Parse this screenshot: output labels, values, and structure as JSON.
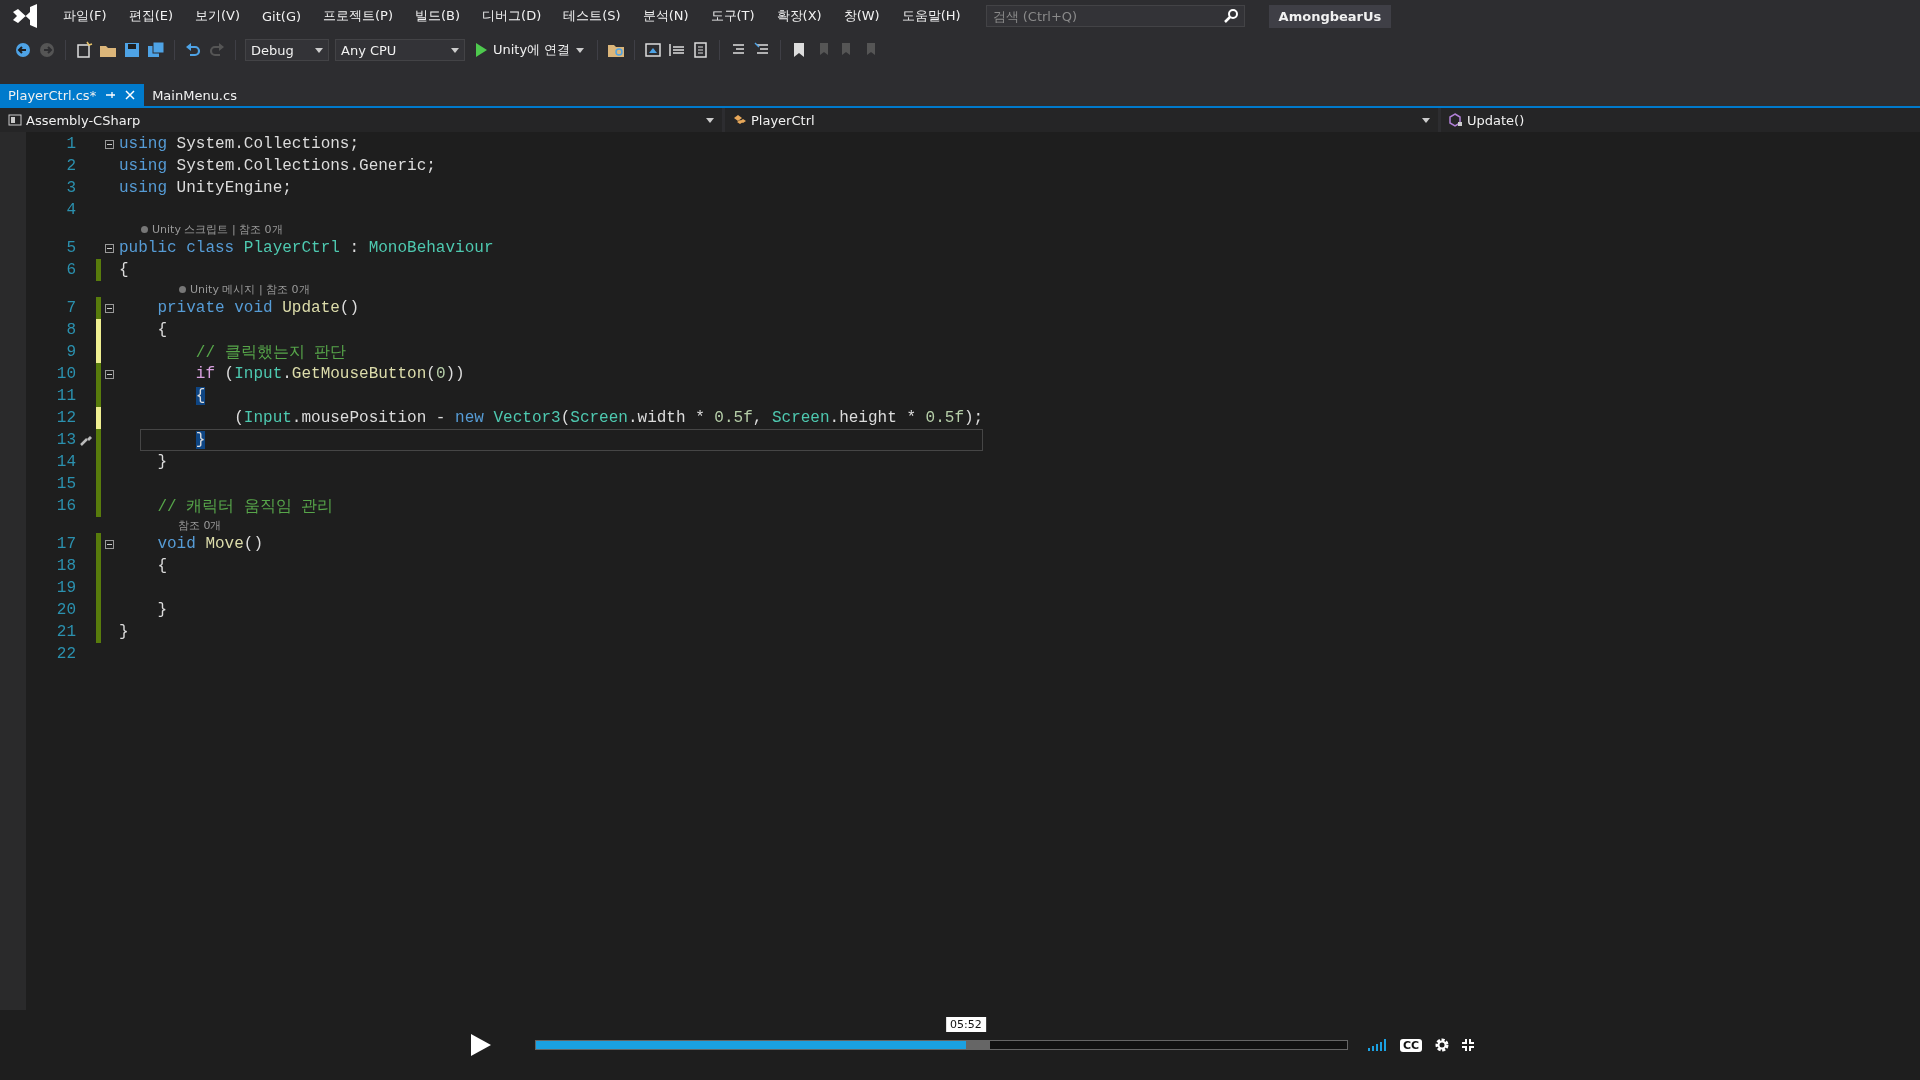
{
  "menu": [
    "파일(F)",
    "편집(E)",
    "보기(V)",
    "Git(G)",
    "프로젝트(P)",
    "빌드(B)",
    "디버그(D)",
    "테스트(S)",
    "분석(N)",
    "도구(T)",
    "확장(X)",
    "창(W)",
    "도움말(H)"
  ],
  "search": {
    "placeholder": "검색 (Ctrl+Q)"
  },
  "solution_name": "AmongbearUs",
  "toolbar": {
    "configuration": "Debug",
    "platform": "Any CPU",
    "run_label": "Unity에 연결"
  },
  "tabs": [
    {
      "label": "PlayerCtrl.cs*",
      "selected": true
    },
    {
      "label": "MainMenu.cs",
      "selected": false
    }
  ],
  "navigation": [
    "Assembly-CSharp",
    "PlayerCtrl",
    "Update()"
  ],
  "lines": [
    {
      "kind": "code",
      "number": "1",
      "fold": true,
      "current": false,
      "tokens": [
        {
          "kind": "keyword",
          "text": "using"
        },
        {
          "kind": "plain",
          "text": " System.Collections;"
        }
      ]
    },
    {
      "kind": "code",
      "number": "2",
      "fold": false,
      "current": false,
      "tokens": [
        {
          "kind": "keyword",
          "text": "using"
        },
        {
          "kind": "plain",
          "text": " System.Collections.Generic;"
        }
      ]
    },
    {
      "kind": "code",
      "number": "3",
      "fold": false,
      "current": false,
      "tokens": [
        {
          "kind": "keyword",
          "text": "using"
        },
        {
          "kind": "plain",
          "text": " UnityEngine;"
        }
      ]
    },
    {
      "kind": "code",
      "number": "4",
      "fold": false,
      "current": false
    },
    {
      "kind": "lens",
      "icon": true,
      "text": "Unity 스크립트 | 참조 0개"
    },
    {
      "kind": "code",
      "number": "5",
      "fold": true,
      "current": false,
      "tokens": [
        {
          "kind": "keyword",
          "text": "public"
        },
        {
          "kind": "keyword",
          "text": " class"
        },
        {
          "kind": "type",
          "text": " PlayerCtrl"
        },
        {
          "kind": "plain",
          "text": " : "
        },
        {
          "kind": "type",
          "text": "MonoBehaviour"
        }
      ]
    },
    {
      "kind": "code",
      "number": "6",
      "fold": false,
      "change": {
        "color": "#587c0c"
      },
      "current": false,
      "tokens": [
        {
          "kind": "plain",
          "text": "{"
        }
      ]
    },
    {
      "kind": "lens",
      "icon": true,
      "text": "Unity 메시지 | 참조 0개"
    },
    {
      "kind": "code",
      "number": "7",
      "fold": true,
      "change": {
        "color": "#587c0c"
      },
      "current": false,
      "tokens": [
        {
          "kind": "keyword",
          "text": "    private"
        },
        {
          "kind": "keyword",
          "text": " void"
        },
        {
          "kind": "method",
          "text": " Update"
        },
        {
          "kind": "plain",
          "text": "()"
        }
      ]
    },
    {
      "kind": "code",
      "number": "8",
      "fold": false,
      "change": {
        "color": "#efef91"
      },
      "current": false,
      "tokens": [
        {
          "kind": "plain",
          "text": "    {"
        }
      ]
    },
    {
      "kind": "code",
      "number": "9",
      "fold": false,
      "change": {
        "color": "#efef91"
      },
      "current": false,
      "tokens": [
        {
          "kind": "comment",
          "text": "        // 클릭했는지 판단"
        }
      ]
    },
    {
      "kind": "code",
      "number": "10",
      "fold": true,
      "change": {
        "color": "#587c0c"
      },
      "current": false,
      "tokens": [
        {
          "kind": "control",
          "text": "        if"
        },
        {
          "kind": "plain",
          "text": " ("
        },
        {
          "kind": "type",
          "text": "Input"
        },
        {
          "kind": "plain",
          "text": "."
        },
        {
          "kind": "method",
          "text": "GetMouseButton"
        },
        {
          "kind": "plain",
          "text": "("
        },
        {
          "kind": "number",
          "text": "0"
        },
        {
          "kind": "plain",
          "text": "))"
        }
      ]
    },
    {
      "kind": "code",
      "number": "11",
      "fold": false,
      "change": {
        "color": "#587c0c"
      },
      "current": false,
      "tokens": [
        {
          "kind": "brace-match",
          "text": "        {"
        }
      ]
    },
    {
      "kind": "code",
      "number": "12",
      "fold": false,
      "change": {
        "color": "#efef91"
      },
      "current": false,
      "tokens": [
        {
          "kind": "plain",
          "text": "            ("
        },
        {
          "kind": "type",
          "text": "Input"
        },
        {
          "kind": "plain",
          "text": ".mousePosition - "
        },
        {
          "kind": "keyword",
          "text": "new"
        },
        {
          "kind": "type",
          "text": " Vector3"
        },
        {
          "kind": "plain",
          "text": "("
        },
        {
          "kind": "type",
          "text": "Screen"
        },
        {
          "kind": "plain",
          "text": ".width * "
        },
        {
          "kind": "number",
          "text": "0.5f"
        },
        {
          "kind": "plain",
          "text": ", "
        },
        {
          "kind": "type",
          "text": "Screen"
        },
        {
          "kind": "plain",
          "text": ".height * "
        },
        {
          "kind": "number",
          "text": "0.5f"
        },
        {
          "kind": "plain",
          "text": ");"
        }
      ]
    },
    {
      "kind": "code",
      "number": "13",
      "fold": false,
      "change": {
        "color": "#587c0c"
      },
      "current": true,
      "tokens": [
        {
          "kind": "brace-match",
          "text": "        }"
        }
      ]
    },
    {
      "kind": "code",
      "number": "14",
      "fold": false,
      "change": {
        "color": "#587c0c"
      },
      "current": false,
      "tokens": [
        {
          "kind": "plain",
          "text": "    }"
        }
      ]
    },
    {
      "kind": "code",
      "number": "15",
      "fold": false,
      "change": {
        "color": "#587c0c"
      },
      "current": false
    },
    {
      "kind": "code",
      "number": "16",
      "fold": false,
      "change": {
        "color": "#587c0c"
      },
      "current": false,
      "tokens": [
        {
          "kind": "comment",
          "text": "    // 캐릭터 움직임 관리"
        }
      ]
    },
    {
      "kind": "lens",
      "icon": false,
      "text": "참조 0개"
    },
    {
      "kind": "code",
      "number": "17",
      "fold": true,
      "change": {
        "color": "#587c0c"
      },
      "current": false,
      "tokens": [
        {
          "kind": "keyword",
          "text": "    void"
        },
        {
          "kind": "method",
          "text": " Move"
        },
        {
          "kind": "plain",
          "text": "()"
        }
      ]
    },
    {
      "kind": "code",
      "number": "18",
      "fold": false,
      "change": {
        "color": "#587c0c"
      },
      "current": false,
      "tokens": [
        {
          "kind": "plain",
          "text": "    {"
        }
      ]
    },
    {
      "kind": "code",
      "number": "19",
      "fold": false,
      "change": {
        "color": "#587c0c"
      },
      "current": false
    },
    {
      "kind": "code",
      "number": "20",
      "fold": false,
      "change": {
        "color": "#587c0c"
      },
      "current": false,
      "tokens": [
        {
          "kind": "plain",
          "text": "    }"
        }
      ]
    },
    {
      "kind": "code",
      "number": "21",
      "fold": false,
      "change": {
        "color": "#587c0c"
      },
      "current": false,
      "tokens": [
        {
          "kind": "plain",
          "text": "}"
        }
      ]
    },
    {
      "kind": "code",
      "number": "22",
      "fold": false,
      "current": false
    }
  ],
  "player": {
    "timestamp": "05:52",
    "level": 0.53,
    "buffer": {
      "level": 0.56
    },
    "captions": "CC"
  }
}
